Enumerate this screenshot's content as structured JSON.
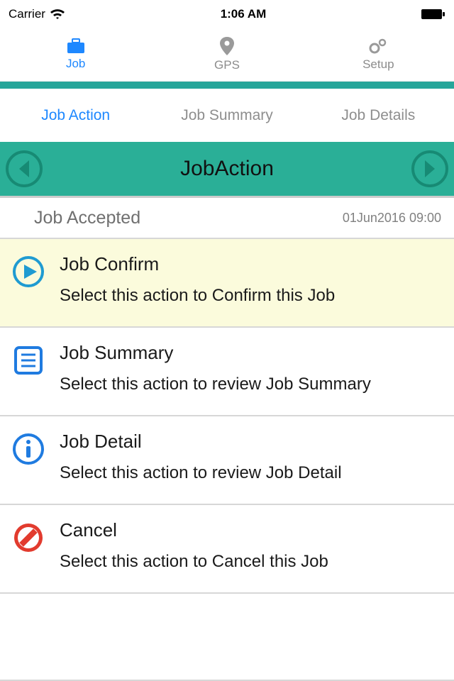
{
  "status_bar": {
    "carrier": "Carrier",
    "time": "1:06 AM"
  },
  "top_tabs": {
    "job": "Job",
    "gps": "GPS",
    "setup": "Setup"
  },
  "sec_tabs": {
    "action": "Job Action",
    "summary": "Job Summary",
    "details": "Job Details"
  },
  "green_bar": {
    "title": "JobAction"
  },
  "status_row": {
    "label": "Job Accepted",
    "timestamp": "01Jun2016 09:00"
  },
  "actions": {
    "confirm": {
      "title": "Job Confirm",
      "desc": "Select this action to Confirm this Job"
    },
    "summary": {
      "title": "Job Summary",
      "desc": "Select this action to review Job Summary"
    },
    "detail": {
      "title": "Job Detail",
      "desc": "Select this action to review Job Detail"
    },
    "cancel": {
      "title": "Cancel",
      "desc": "Select this action to Cancel this Job"
    }
  }
}
